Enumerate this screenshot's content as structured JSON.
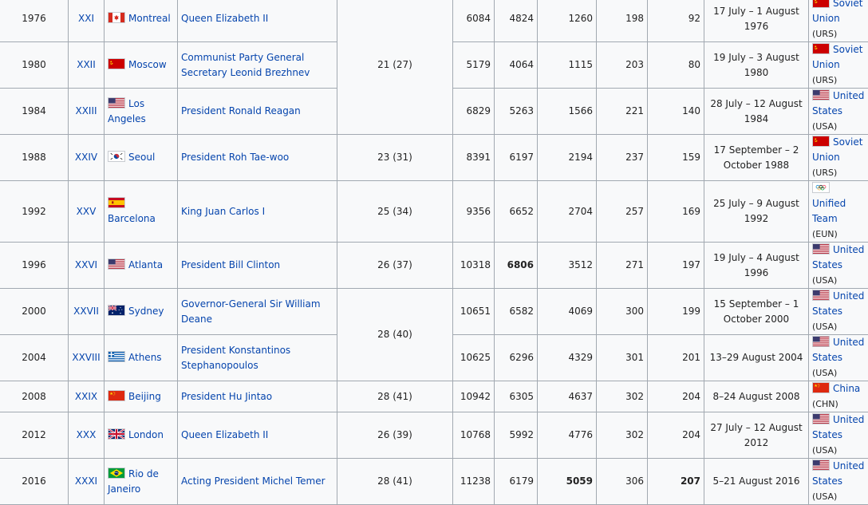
{
  "rows": [
    {
      "year": "1976",
      "roman": "XXI",
      "city": "Montreal",
      "flag": "canada",
      "opened_by": "Queen Elizabeth II",
      "nations": "21 (27)",
      "nations_rowspan": 3,
      "competitors_total": "6084",
      "men": "4824",
      "women": "1260",
      "events": "198",
      "medal_events": "92",
      "dates": "17 July – 1 August 1976",
      "champion": "Soviet Union",
      "champion_code": "(URS)",
      "champion_flag": "ussr",
      "bold": []
    },
    {
      "year": "1980",
      "roman": "XXII",
      "city": "Moscow",
      "flag": "ussr",
      "opened_by": "Communist Party General Secretary Leonid Brezhnev",
      "competitors_total": "5179",
      "men": "4064",
      "women": "1115",
      "events": "203",
      "medal_events": "80",
      "dates": "19 July – 3 August 1980",
      "champion": "Soviet Union",
      "champion_code": "(URS)",
      "champion_flag": "ussr",
      "bold": []
    },
    {
      "year": "1984",
      "roman": "XXIII",
      "city": "Los Angeles",
      "flag": "usa",
      "opened_by": "President Ronald Reagan",
      "competitors_total": "6829",
      "men": "5263",
      "women": "1566",
      "events": "221",
      "medal_events": "140",
      "dates": "28 July – 12 August 1984",
      "champion": "United States",
      "champion_code": "(USA)",
      "champion_flag": "usa",
      "bold": []
    },
    {
      "year": "1988",
      "roman": "XXIV",
      "city": "Seoul",
      "flag": "korea",
      "opened_by": "President Roh Tae-woo",
      "nations": "23 (31)",
      "competitors_total": "8391",
      "men": "6197",
      "women": "2194",
      "events": "237",
      "medal_events": "159",
      "dates": "17 September – 2 October 1988",
      "champion": "Soviet Union",
      "champion_code": "(URS)",
      "champion_flag": "ussr",
      "bold": []
    },
    {
      "year": "1992",
      "roman": "XXV",
      "city": "Barcelona",
      "flag": "spain",
      "opened_by": "King Juan Carlos I",
      "nations": "25 (34)",
      "competitors_total": "9356",
      "men": "6652",
      "women": "2704",
      "events": "257",
      "medal_events": "169",
      "dates": "25 July – 9 August 1992",
      "champion": "Unified Team",
      "champion_code": "(EUN)",
      "champion_flag": "olympic",
      "bold": []
    },
    {
      "year": "1996",
      "roman": "XXVI",
      "city": "Atlanta",
      "flag": "usa",
      "opened_by": "President Bill Clinton",
      "nations": "26 (37)",
      "competitors_total": "10318",
      "men": "6806",
      "women": "3512",
      "events": "271",
      "medal_events": "197",
      "dates": "19 July – 4 August 1996",
      "champion": "United States",
      "champion_code": "(USA)",
      "champion_flag": "usa",
      "bold": [
        "men"
      ]
    },
    {
      "year": "2000",
      "roman": "XXVII",
      "city": "Sydney",
      "flag": "australia",
      "opened_by": "Governor-General Sir William Deane",
      "nations": "28 (40)",
      "nations_rowspan": 2,
      "competitors_total": "10651",
      "men": "6582",
      "women": "4069",
      "events": "300",
      "medal_events": "199",
      "dates": "15 September – 1 October 2000",
      "champion": "United States",
      "champion_code": "(USA)",
      "champion_flag": "usa",
      "bold": []
    },
    {
      "year": "2004",
      "roman": "XXVIII",
      "city": "Athens",
      "flag": "greece",
      "opened_by": "President Konstantinos Stephanopoulos",
      "competitors_total": "10625",
      "men": "6296",
      "women": "4329",
      "events": "301",
      "medal_events": "201",
      "dates": "13–29 August 2004",
      "champion": "United States",
      "champion_code": "(USA)",
      "champion_flag": "usa",
      "bold": []
    },
    {
      "year": "2008",
      "roman": "XXIX",
      "city": "Beijing",
      "flag": "china",
      "opened_by": "President Hu Jintao",
      "nations": "28 (41)",
      "competitors_total": "10942",
      "men": "6305",
      "women": "4637",
      "events": "302",
      "medal_events": "204",
      "dates": "8–24 August 2008",
      "champion": "China",
      "champion_code": "(CHN)",
      "champion_flag": "china",
      "bold": []
    },
    {
      "year": "2012",
      "roman": "XXX",
      "city": "London",
      "flag": "uk",
      "opened_by": "Queen Elizabeth II",
      "nations": "26 (39)",
      "competitors_total": "10768",
      "men": "5992",
      "women": "4776",
      "events": "302",
      "medal_events": "204",
      "dates": "27 July – 12 August 2012",
      "champion": "United States",
      "champion_code": "(USA)",
      "champion_flag": "usa",
      "bold": []
    },
    {
      "year": "2016",
      "roman": "XXXI",
      "city": "Rio de Janeiro",
      "flag": "brazil",
      "opened_by": "Acting President Michel Temer",
      "nations": "28 (41)",
      "competitors_total": "11238",
      "men": "6179",
      "women": "5059",
      "events": "306",
      "medal_events": "207",
      "dates": "5–21 August 2016",
      "champion": "United States",
      "champion_code": "(USA)",
      "champion_flag": "usa",
      "bold": [
        "women",
        "medal_events"
      ]
    }
  ],
  "colors": {
    "link": "#0645ad",
    "cell_bg": "#f8f9fa",
    "border": "#a2a9b1",
    "text": "#222222"
  }
}
